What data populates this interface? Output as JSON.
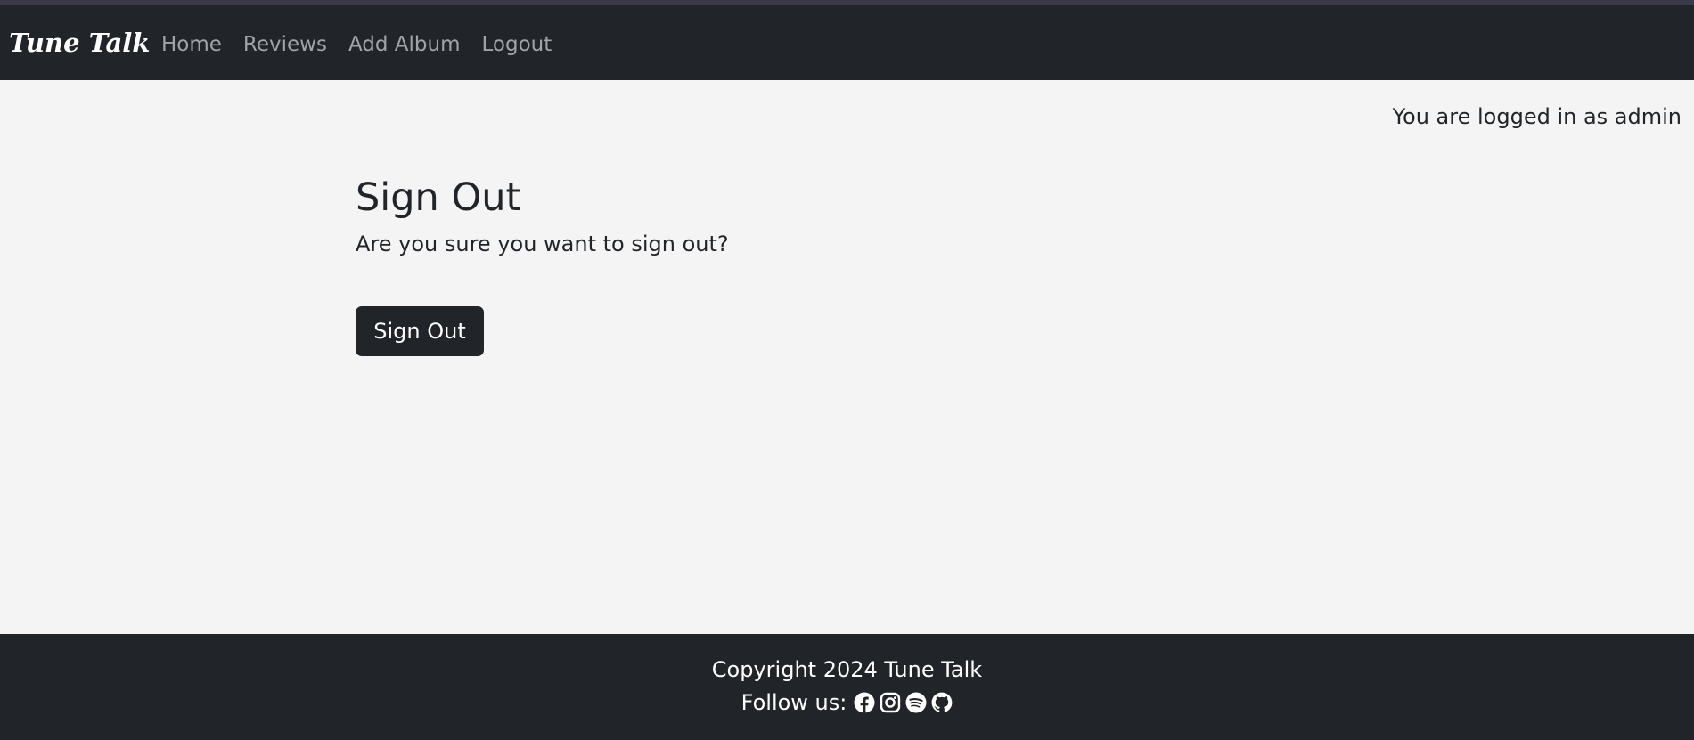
{
  "brand": {
    "name": "Tune Talk"
  },
  "nav": {
    "items": [
      {
        "label": "Home"
      },
      {
        "label": "Reviews"
      },
      {
        "label": "Add Album"
      },
      {
        "label": "Logout"
      }
    ]
  },
  "status": {
    "login_text": "You are logged in as admin"
  },
  "main": {
    "title": "Sign Out",
    "prompt": "Are you sure you want to sign out?",
    "button_label": "Sign Out"
  },
  "footer": {
    "copyright": "Copyright 2024 Tune Talk",
    "follow_label": "Follow us:",
    "social_icons": [
      "facebook-icon",
      "instagram-icon",
      "spotify-icon",
      "github-icon"
    ]
  },
  "colors": {
    "navbar_bg": "#212529",
    "page_bg": "#f4f4f4",
    "nav_link": "#a1a3a7",
    "button_bg": "#212529",
    "text_dark": "#212529",
    "text_light": "#ffffff"
  }
}
